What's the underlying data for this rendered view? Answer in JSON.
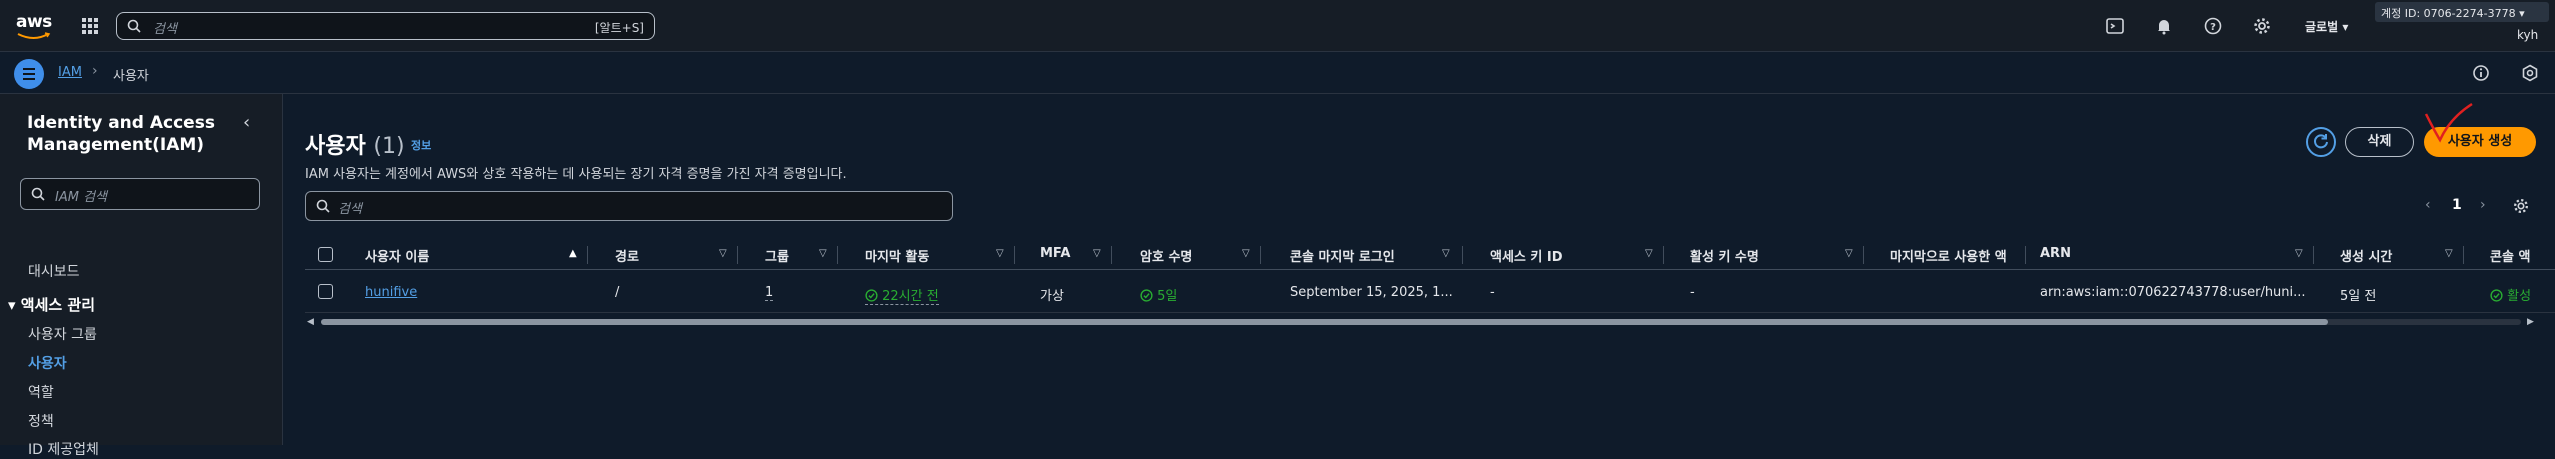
{
  "topbar": {
    "logo_text": "aws",
    "search_placeholder": "검색",
    "search_shortcut": "[알트+S]",
    "region_label": "글로벌",
    "account_label": "계정 ID: 0706-2274-3778",
    "user_label": "kyh",
    "icons": [
      "cloudshell-icon",
      "bell-icon",
      "help-icon",
      "gear-icon"
    ]
  },
  "breadcrumb": {
    "root": "IAM",
    "current": "사용자"
  },
  "sidebar": {
    "title": "Identity and Access Management(IAM)",
    "search_placeholder": "IAM 검색",
    "dashboard": "대시보드",
    "group_label": "액세스 관리",
    "items": [
      "사용자 그룹",
      "사용자",
      "역할",
      "정책",
      "ID 제공업체"
    ],
    "active_index": 1
  },
  "page": {
    "title": "사용자",
    "count": "(1)",
    "info_link": "정보",
    "description": "IAM 사용자는 계정에서 AWS와 상호 작용하는 데 사용되는 장기 자격 증명을 가진 자격 증명입니다.",
    "delete_button": "삭제",
    "create_button": "사용자 생성",
    "table_search_placeholder": "검색",
    "page_number": "1"
  },
  "table": {
    "columns": [
      "사용자 이름",
      "경로",
      "그룹",
      "마지막 활동",
      "MFA",
      "암호 수명",
      "콘솔 마지막 로그인",
      "액세스 키 ID",
      "활성 키 수명",
      "마지막으로 사용한 액",
      "ARN",
      "생성 시간",
      "콘솔 액"
    ],
    "rows": [
      {
        "user_name": "hunifive",
        "path": "/",
        "groups": "1",
        "last_activity": "22시간 전",
        "mfa": "가상",
        "password_age": "5일",
        "console_last_login": "September 15, 2025, 1...",
        "access_key_id": "-",
        "active_key_age": "-",
        "last_used": "",
        "arn": "arn:aws:iam::070622743778:user/huni...",
        "created": "5일 전",
        "console_access": "활성"
      }
    ]
  },
  "colors": {
    "accent": "#539fe5",
    "primary_button": "#ff9900",
    "success": "#29ad32",
    "background": "#0f1b2a",
    "panel": "#161d26"
  }
}
